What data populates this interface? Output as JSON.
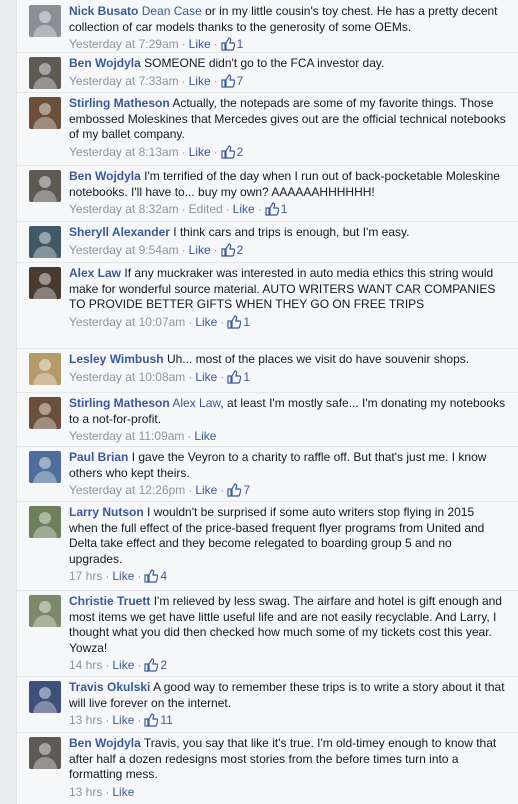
{
  "comments": [
    {
      "author": "Nick Busato",
      "mention": "Dean Case",
      "text": " or in my little cousin's toy chest. He has a pretty decent collection of car models thanks to the generosity of some OEMs.",
      "time": "Yesterday at 7:29am",
      "edited": "",
      "like": "Like",
      "likes": "1",
      "avatar": "#8a8f96"
    },
    {
      "author": "Ben Wojdyla",
      "mention": "",
      "text": "SOMEONE didn't go to the FCA investor day.",
      "time": "Yesterday at 7:33am",
      "edited": "",
      "like": "Like",
      "likes": "7",
      "avatar": "#5e5a52"
    },
    {
      "author": "Stirling Matheson",
      "mention": "",
      "text": "Actually, the notepads are some of my favorite things. Those embossed Moleskines that Mercedes gives out are the official technical notebooks of my ballet company.",
      "time": "Yesterday at 8:13am",
      "edited": "",
      "like": "Like",
      "likes": "2",
      "avatar": "#6b4f3a"
    },
    {
      "author": "Ben Wojdyla",
      "mention": "",
      "text": "I'm terrified of the day when I run out of back-pocketable Moleskine notebooks. I'll have to... buy my own? AAAAAAHHHHHH!",
      "time": "Yesterday at 8:32am",
      "edited": "Edited",
      "like": "Like",
      "likes": "1",
      "avatar": "#5e5a52"
    },
    {
      "author": "Sheryll Alexander",
      "mention": "",
      "text": "I think cars and trips is enough, but I'm easy.",
      "time": "Yesterday at 9:54am",
      "edited": "",
      "like": "Like",
      "likes": "2",
      "avatar": "#3f5a64"
    },
    {
      "author": "Alex Law",
      "mention": "",
      "text": "If any muckraker was interested in auto media ethics this string would make for wonderful source material. AUTO WRITERS WANT CAR COMPANIES TO PROVIDE BETTER GIFTS WHEN THEY GO ON FREE TRIPS",
      "time": "Yesterday at 10:07am",
      "edited": "",
      "like": "Like",
      "likes": "1",
      "avatar": "#4a3b30"
    },
    {
      "author": "Lesley Wimbush",
      "mention": "",
      "text": "Uh... most of the places we visit do have souvenir shops.",
      "time": "Yesterday at 10:08am",
      "edited": "",
      "like": "Like",
      "likes": "1",
      "avatar": "#b59a6a"
    },
    {
      "author": "Stirling Matheson",
      "mention": "Alex Law",
      "text": ", at least I'm mostly safe... I'm donating my notebooks to a not-for-profit.",
      "time": "Yesterday at 11:09am",
      "edited": "",
      "like": "Like",
      "likes": "",
      "avatar": "#6b4f3a"
    },
    {
      "author": "Paul Brian",
      "mention": "",
      "text": "I gave the Veyron to a charity to raffle off. But that's just me. I know others who kept theirs.",
      "time": "Yesterday at 12:26pm",
      "edited": "",
      "like": "Like",
      "likes": "7",
      "avatar": "#4d6d9a"
    },
    {
      "author": "Larry Nutson",
      "mention": "",
      "text": "I wouldn't be surprised if some auto writers stop flying in 2015 when the full effect of the price-based frequent flyer programs from United and Delta take effect and they become relegated to boarding group 5 and no upgrades.",
      "time": "17 hrs",
      "edited": "",
      "like": "Like",
      "likes": "4",
      "avatar": "#6e7f5c"
    },
    {
      "author": "Christie Truett",
      "mention": "",
      "text": "I'm relieved by less swag. The airfare and hotel is gift enough and most items we get have little useful life and are not easily recyclable. And Larry, I thought what you did then checked how much some of my tickets cost this year. Yowza!",
      "time": "14 hrs",
      "edited": "",
      "like": "Like",
      "likes": "2",
      "avatar": "#7a8a6a"
    },
    {
      "author": "Travis Okulski",
      "mention": "",
      "text": "A good way to remember these trips is to write a story about it that will live forever on the internet.",
      "time": "13 hrs",
      "edited": "",
      "like": "Like",
      "likes": "11",
      "avatar": "#3e4f7a"
    },
    {
      "author": "Ben Wojdyla",
      "mention": "",
      "text": "Travis, you say that like it's true. I'm old-timey enough to know that after half a dozen redesigns most stories from the before times turn into a formatting mess.",
      "time": "13 hrs",
      "edited": "",
      "like": "Like",
      "likes": "",
      "avatar": "#5e5a52"
    }
  ]
}
